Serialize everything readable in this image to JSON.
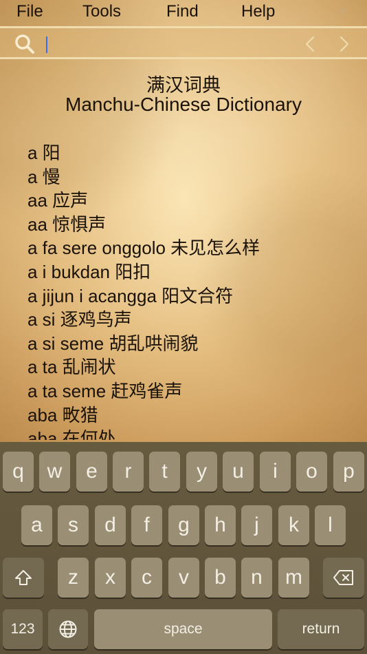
{
  "menu": {
    "file": "File",
    "tools": "Tools",
    "find": "Find",
    "help": "Help",
    "up_icon": "arrow-up-icon"
  },
  "search": {
    "value": "",
    "icon": "search-icon",
    "prev_icon": "chevron-left-icon",
    "next_icon": "chevron-right-icon"
  },
  "header": {
    "title_zh": "满汉词典",
    "title_en": "Manchu-Chinese Dictionary"
  },
  "entries": [
    "a 阳",
    "a 慢",
    "aa 应声",
    "aa 惊惧声",
    "a fa sere onggolo 未见怎么样",
    "a i bukdan 阳扣",
    "a jijun i acangga 阳文合符",
    "a si 逐鸡鸟声",
    "a si seme 胡乱哄闹貌",
    "a ta 乱闹状",
    "a ta seme 赶鸡雀声",
    "aba 畋猎",
    "aba 在何处"
  ],
  "keyboard": {
    "row1": [
      "q",
      "w",
      "e",
      "r",
      "t",
      "y",
      "u",
      "i",
      "o",
      "p"
    ],
    "row2": [
      "a",
      "s",
      "d",
      "f",
      "g",
      "h",
      "j",
      "k",
      "l"
    ],
    "row3": [
      "z",
      "x",
      "c",
      "v",
      "b",
      "n",
      "m"
    ],
    "numbers": "123",
    "space": "space",
    "return": "return",
    "shift_icon": "shift-icon",
    "delete_icon": "delete-icon",
    "globe_icon": "globe-icon"
  },
  "colors": {
    "accent_caret": "#3b6ef5",
    "text": "#1a1208",
    "keyboard_bg": "#5f533b",
    "key_bg": "#9a8e74"
  }
}
